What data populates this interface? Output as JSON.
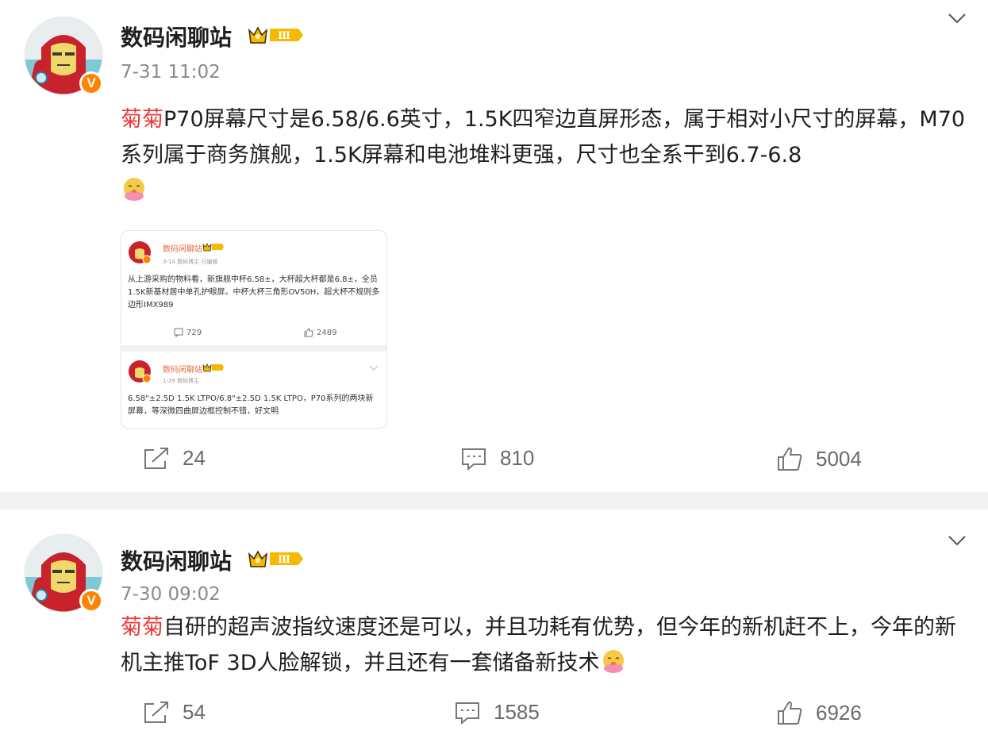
{
  "posts": [
    {
      "author": "数码闲聊站",
      "time": "7-31 11:02",
      "hashtag": "菊菊",
      "text": "P70屏幕尺寸是6.58/6.6英寸，1.5K四窄边直屏形态，属于相对小尺寸的屏幕，M70系列属于商务旗舰，1.5K屏幕和电池堆料更强，尺寸也全系干到6.7-6.8",
      "emoji": "doge-face-emoji",
      "repost_count": "24",
      "comment_count": "810",
      "like_count": "5004",
      "embedded": {
        "post1": {
          "author": "数码闲聊站",
          "meta": "3-14  数码博主  已编辑",
          "text": "从上游采购的物料看，新旗舰中杯6.58±，大杯超大杯都是6.8±，全员1.5K新基材居中单孔护眼屏。中杯大杯三角形OV50H，超大杯不规则多边形IMX989",
          "comments": "729",
          "likes": "2489"
        },
        "post2": {
          "author": "数码闲聊站",
          "meta": "1-29  数码博主",
          "text": "6.58\"±2.5D 1.5K LTPO/6.8\"±2.5D 1.5K LTPO，P70系列的两块新屏幕，等深微四曲屏边框控制不错，好文明"
        }
      }
    },
    {
      "author": "数码闲聊站",
      "time": "7-30 09:02",
      "hashtag": "菊菊",
      "text": "自研的超声波指纹速度还是可以，并且功耗有优势，但今年的新机赶不上，今年的新机主推ToF 3D人脸解锁，并且还有一套储备新技术",
      "emoji": "doge-face-emoji",
      "repost_count": "54",
      "comment_count": "1585",
      "like_count": "6926"
    }
  ],
  "badge_letter": "V",
  "vip_level": "Ⅲ",
  "colors": {
    "hashtag": "#eb3b3b",
    "badge": "#ff8200",
    "vip_gold": "#f6b800",
    "muted": "#8a8a8a"
  }
}
